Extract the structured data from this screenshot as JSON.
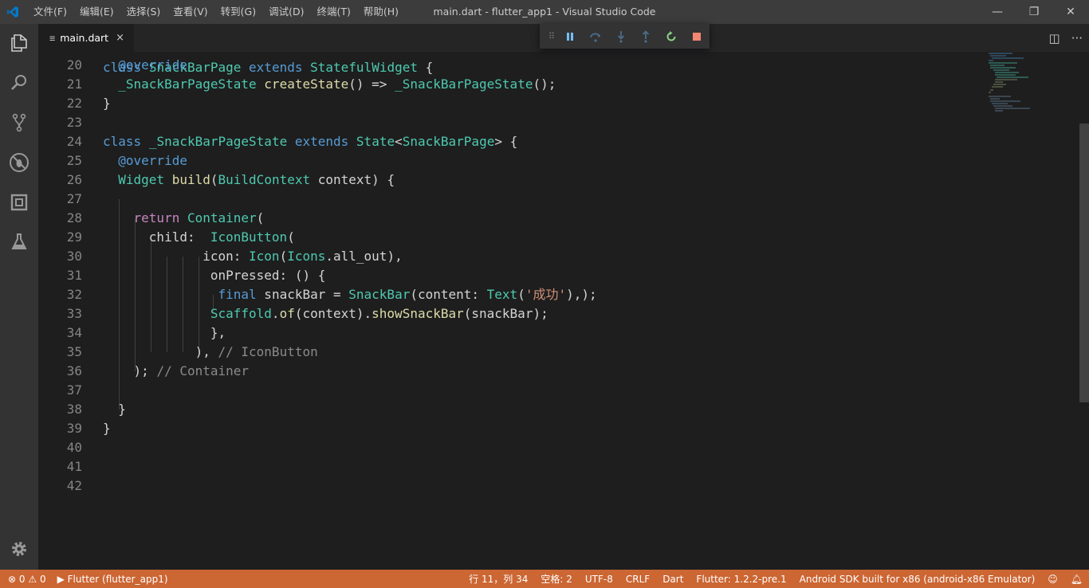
{
  "window": {
    "title": "main.dart - flutter_app1 - Visual Studio Code",
    "controls": [
      "—",
      "❐",
      "✕"
    ]
  },
  "menu": [
    "文件(F)",
    "编辑(E)",
    "选择(S)",
    "查看(V)",
    "转到(G)",
    "调试(D)",
    "终端(T)",
    "帮助(H)"
  ],
  "tab": {
    "label": "main.dart",
    "close": "×",
    "file_icon": "≡"
  },
  "tab_actions": {
    "split": "◫",
    "more": "···"
  },
  "debug_toolbar": {
    "items": [
      "pause",
      "step-over",
      "step-into",
      "step-out",
      "restart",
      "stop"
    ],
    "colors": {
      "pause": "#75beff",
      "step": "#75beff",
      "restart": "#89d185",
      "stop": "#f48771"
    }
  },
  "editor": {
    "line_numbers": [
      "20",
      "21",
      "22",
      "23",
      "24",
      "25",
      "26",
      "27",
      "28",
      "29",
      "30",
      "31",
      "32",
      "33",
      "34",
      "35",
      "36",
      "37",
      "38",
      "39",
      "40",
      "41",
      "42"
    ]
  },
  "status": {
    "errors": "0",
    "warnings": "0",
    "debug_target": "Flutter (flutter_app1)",
    "position": "行 11，列 34",
    "spaces": "空格: 2",
    "encoding": "UTF-8",
    "eol": "CRLF",
    "language": "Dart",
    "flutter_version": "Flutter: 1.2.2-pre.1",
    "device": "Android SDK built for x86 (android-x86 Emulator)",
    "background_color": "#cc6633"
  }
}
